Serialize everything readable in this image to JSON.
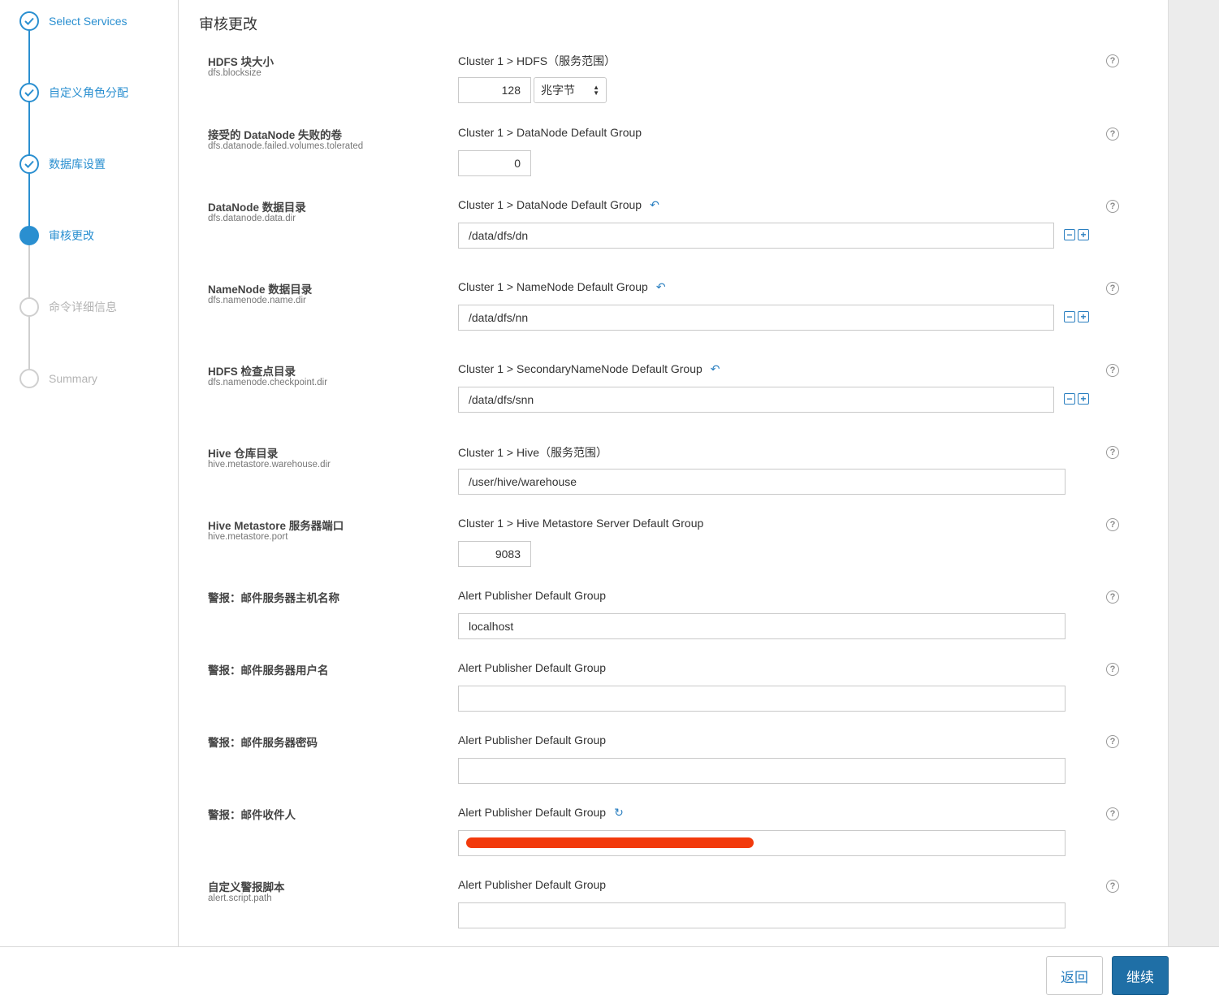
{
  "sidebar": {
    "steps": [
      {
        "label": "Select Services",
        "state": "done"
      },
      {
        "label": "自定义角色分配",
        "state": "done"
      },
      {
        "label": "数据库设置",
        "state": "done"
      },
      {
        "label": "审核更改",
        "state": "current"
      },
      {
        "label": "命令详细信息",
        "state": "todo"
      },
      {
        "label": "Summary",
        "state": "todo"
      }
    ]
  },
  "page": {
    "title": "审核更改"
  },
  "properties": [
    {
      "label": "HDFS 块大小",
      "key": "dfs.blocksize",
      "scope": "Cluster 1 > HDFS（服务范围）",
      "value": "128",
      "unit": "兆字节"
    },
    {
      "label": "接受的 DataNode 失败的卷",
      "key": "dfs.datanode.failed.volumes.tolerated",
      "scope": "Cluster 1 > DataNode Default Group",
      "value": "0"
    },
    {
      "label": "DataNode 数据目录",
      "key": "dfs.datanode.data.dir",
      "scope": "Cluster 1 > DataNode Default Group",
      "value": "/data/dfs/dn"
    },
    {
      "label": "NameNode 数据目录",
      "key": "dfs.namenode.name.dir",
      "scope": "Cluster 1 > NameNode Default Group",
      "value": "/data/dfs/nn"
    },
    {
      "label": "HDFS 检查点目录",
      "key": "dfs.namenode.checkpoint.dir",
      "scope": "Cluster 1 > SecondaryNameNode Default Group",
      "value": "/data/dfs/snn"
    },
    {
      "label": "Hive 仓库目录",
      "key": "hive.metastore.warehouse.dir",
      "scope": "Cluster 1 > Hive（服务范围）",
      "value": "/user/hive/warehouse"
    },
    {
      "label": "Hive Metastore 服务器端口",
      "key": "hive.metastore.port",
      "scope": "Cluster 1 > Hive Metastore Server Default Group",
      "value": "9083"
    },
    {
      "label": "警报：邮件服务器主机名称",
      "key": "",
      "scope": "Alert Publisher Default Group",
      "value": "localhost"
    },
    {
      "label": "警报：邮件服务器用户名",
      "key": "",
      "scope": "Alert Publisher Default Group",
      "value": ""
    },
    {
      "label": "警报：邮件服务器密码",
      "key": "",
      "scope": "Alert Publisher Default Group",
      "value": ""
    },
    {
      "label": "警报：邮件收件人",
      "key": "",
      "scope": "Alert Publisher Default Group",
      "value": ""
    },
    {
      "label": "自定义警报脚本",
      "key": "alert.script.path",
      "scope": "Alert Publisher Default Group",
      "value": ""
    }
  ],
  "icons": {
    "help": "?",
    "undo": "↶",
    "reset": "↻",
    "minus": "−",
    "plus": "+"
  },
  "footer": {
    "back_label": "返回",
    "continue_label": "继续"
  },
  "colors": {
    "accent": "#2a8fd0",
    "primary_button": "#1f6fa6",
    "redaction": "#f23a0c"
  }
}
